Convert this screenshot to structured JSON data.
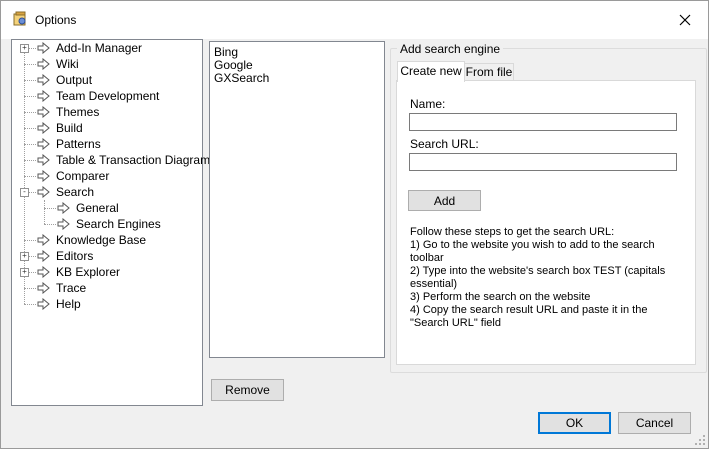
{
  "window": {
    "title": "Options"
  },
  "tree": {
    "items": [
      {
        "label": "Add-In Manager",
        "expander": "+"
      },
      {
        "label": "Wiki"
      },
      {
        "label": "Output"
      },
      {
        "label": "Team Development"
      },
      {
        "label": "Themes"
      },
      {
        "label": "Build"
      },
      {
        "label": "Patterns"
      },
      {
        "label": "Table & Transaction Diagrams"
      },
      {
        "label": "Comparer"
      },
      {
        "label": "Search",
        "expander": "-"
      },
      {
        "label": "General",
        "child": true
      },
      {
        "label": "Search Engines",
        "child": true
      },
      {
        "label": "Knowledge Base"
      },
      {
        "label": "Editors",
        "expander": "+"
      },
      {
        "label": "KB Explorer",
        "expander": "+"
      },
      {
        "label": "Trace"
      },
      {
        "label": "Help"
      }
    ]
  },
  "engines": {
    "items": [
      "Bing",
      "Google",
      "GXSearch"
    ]
  },
  "panel": {
    "group_title": "Add search engine",
    "tabs": [
      "Create new",
      "From file"
    ],
    "name_label": "Name:",
    "name_value": "",
    "url_label": "Search URL:",
    "url_value": "",
    "add_label": "Add",
    "instructions": "Follow these steps to get the search URL:\n1) Go to the website you wish to add to the search toolbar\n2) Type into the website's search box TEST (capitals essential)\n3) Perform the search on the website\n4) Copy the search result URL and paste it in the \"Search URL\" field"
  },
  "buttons": {
    "remove": "Remove",
    "ok": "OK",
    "cancel": "Cancel"
  },
  "colors": {
    "accent": "#0078d7",
    "arrow": "#555555"
  }
}
